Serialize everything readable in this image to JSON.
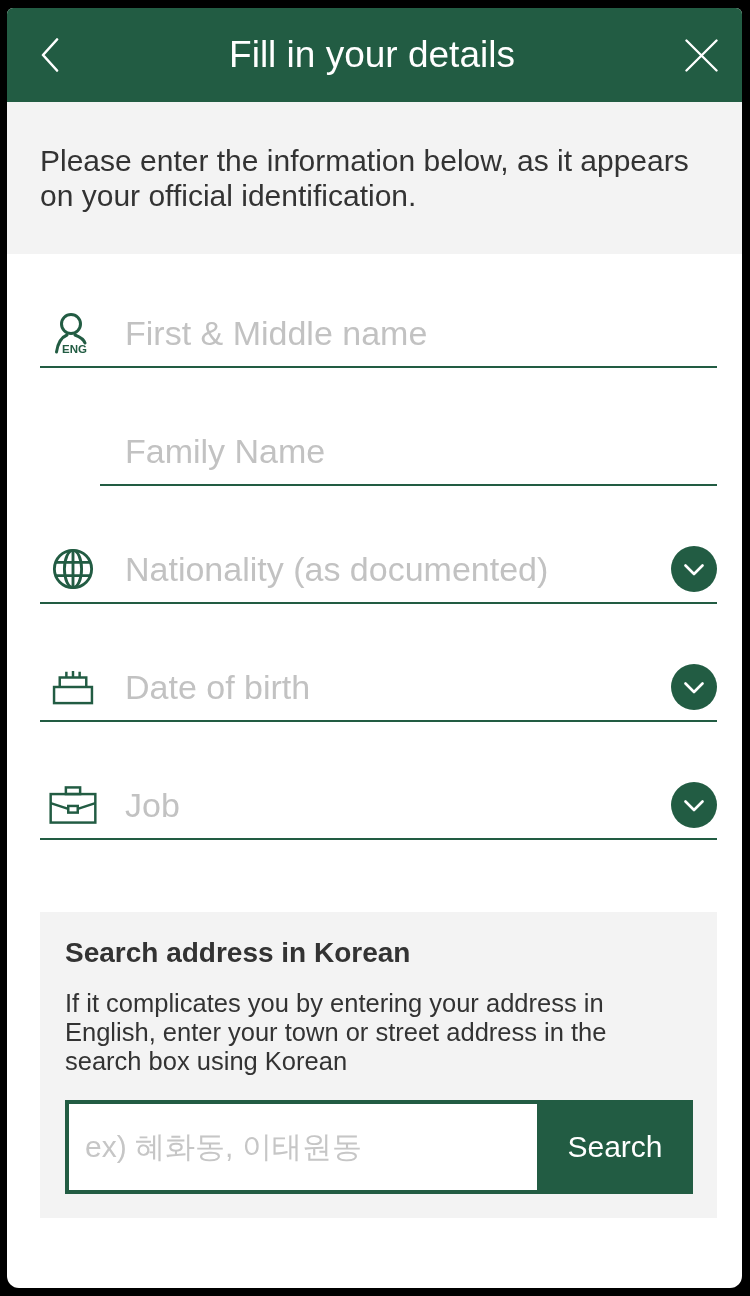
{
  "header": {
    "title": "Fill in your details"
  },
  "intro": {
    "text": "Please enter the information below, as it appears on your official identification."
  },
  "fields": [
    {
      "kind": "text",
      "placeholder": "First & Middle name",
      "icon_label": "ENG"
    },
    {
      "kind": "text",
      "placeholder": "Family Name"
    },
    {
      "kind": "select",
      "placeholder": "Nationality (as documented)"
    },
    {
      "kind": "select",
      "placeholder": "Date of birth"
    },
    {
      "kind": "select",
      "placeholder": "Job"
    }
  ],
  "address_search": {
    "title": "Search address in Korean",
    "description": "If it complicates you by entering your address in English, enter your town or street address in the search box using Korean",
    "placeholder": "ex) 혜화동, 이태원동",
    "button": "Search"
  }
}
